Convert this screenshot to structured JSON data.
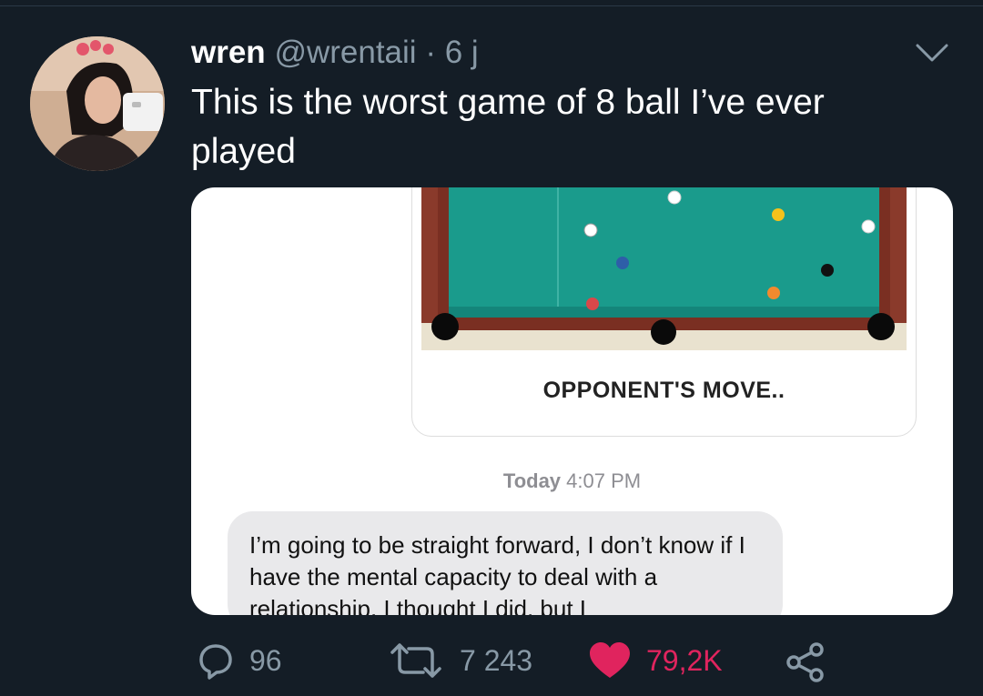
{
  "tweet": {
    "display_name": "wren",
    "handle": "@wrentaii",
    "separator": "·",
    "time": "6 j",
    "text": "This is the worst game of 8 ball I’ve ever played"
  },
  "media": {
    "game_status": "OPPONENT'S MOVE..",
    "timestamp_day": "Today",
    "timestamp_time": "4:07 PM",
    "message": "I’m going to be straight forward, I don’t know if I have the mental capacity to deal with a relationship. I thought I did, but I"
  },
  "actions": {
    "replies": "96",
    "retweets": "7 243",
    "likes": "79,2K"
  },
  "icons": {
    "reply": "reply-icon",
    "retweet": "retweet-icon",
    "like": "heart-icon",
    "share": "share-icon",
    "menu": "chevron-down-icon"
  },
  "colors": {
    "background": "#141d26",
    "secondary_text": "#8899a6",
    "like": "#e0245e",
    "table_felt": "#1a9b8c"
  }
}
